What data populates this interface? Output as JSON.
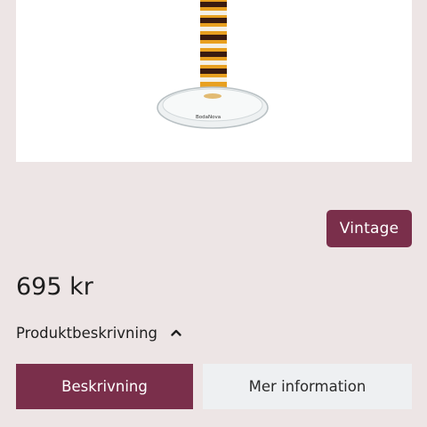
{
  "product": {
    "image_brand_mark": "BodaNova",
    "tag_label": "Vintage",
    "price": "695 kr"
  },
  "description": {
    "toggle_label": "Produktbeskrivning"
  },
  "tabs": [
    {
      "label": "Beskrivning",
      "active": true
    },
    {
      "label": "Mer information",
      "active": false
    }
  ],
  "colors": {
    "accent": "#7a2f4b",
    "page_background": "#ede5e5",
    "inactive_tab": "#eef0f2"
  }
}
